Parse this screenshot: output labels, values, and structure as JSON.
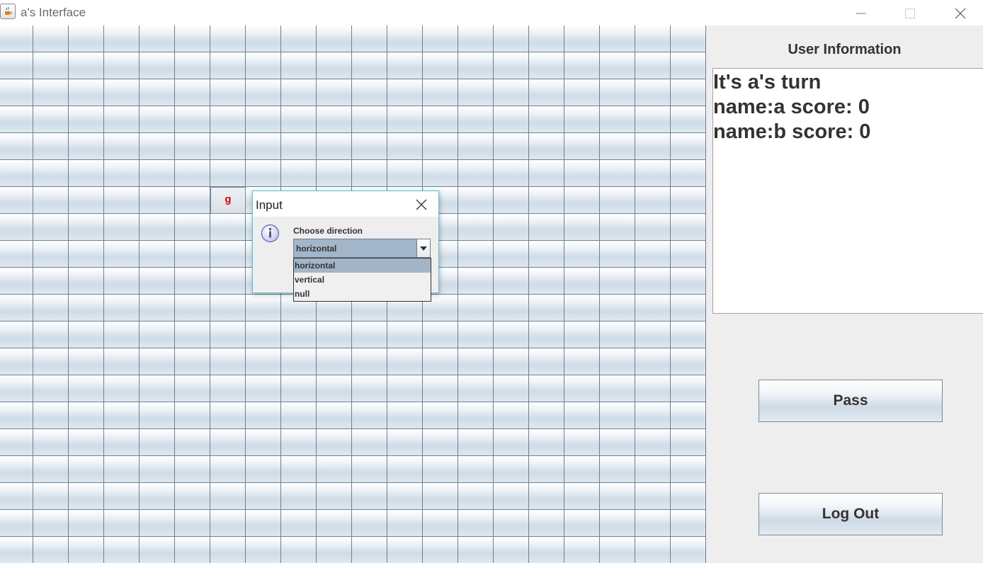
{
  "window": {
    "title": "a's Interface",
    "icon": "java-coffee-cup-icon",
    "controls": [
      "minimize-icon",
      "maximize-icon",
      "close-icon"
    ]
  },
  "board": {
    "columns": 20,
    "rows": 21,
    "placed_tiles": [
      {
        "row": 6,
        "col": 6,
        "letter": "g",
        "color": "#e00000"
      }
    ],
    "tile_colors": {
      "top": "#ffffff",
      "bottom": "#cfdbe6",
      "border": "#6e7f92"
    }
  },
  "sidebar": {
    "title": "User Information",
    "info_lines": [
      "It's a's turn",
      "name:a score: 0",
      "name:b score: 0"
    ],
    "pass_label": "Pass",
    "logout_label": "Log Out"
  },
  "dialog": {
    "title": "Input",
    "icon": "information-icon",
    "label": "Choose direction",
    "selected": "horizontal",
    "options": [
      "horizontal",
      "vertical",
      "null"
    ],
    "accent_color": "#5cc6d0"
  }
}
